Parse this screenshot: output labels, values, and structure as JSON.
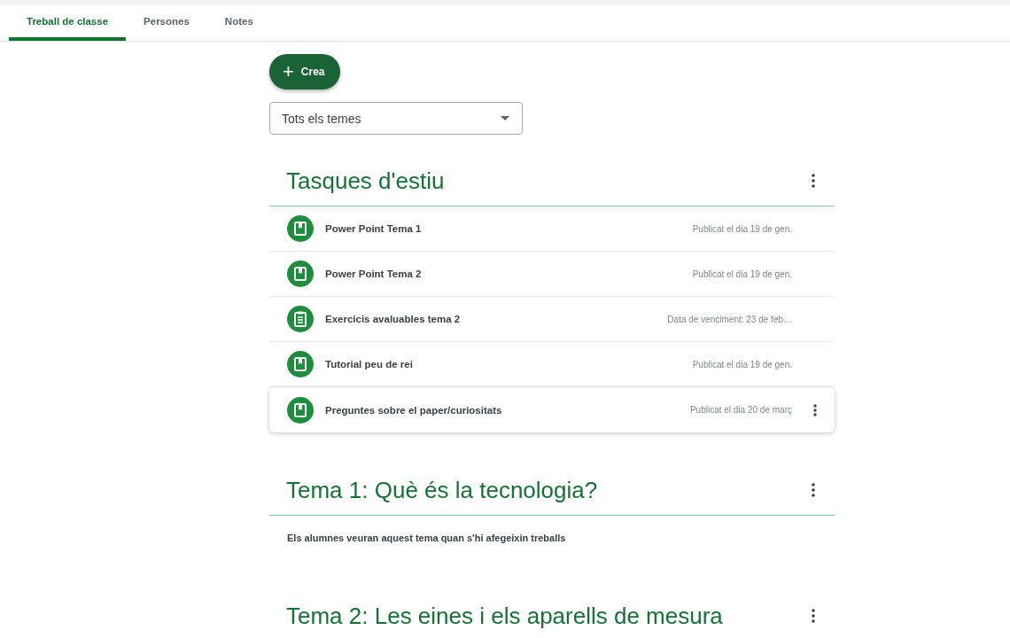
{
  "tabs": [
    {
      "label": "Treball de classe",
      "selected": true
    },
    {
      "label": "Persones",
      "selected": false
    },
    {
      "label": "Notes",
      "selected": false
    }
  ],
  "create_button": {
    "icon": "+",
    "label": "Crea"
  },
  "topic_filter": {
    "value": "Tots els temes"
  },
  "topics": [
    {
      "title": "Tasques d'estiu",
      "items": [
        {
          "kind": "material",
          "title": "Power Point Tema 1",
          "meta": "Publicat el dia 19 de gen.",
          "selected": false
        },
        {
          "kind": "material",
          "title": "Power Point Tema 2",
          "meta": "Publicat el dia 19 de gen.",
          "selected": false
        },
        {
          "kind": "assignment",
          "title": "Exercicis avaluables tema 2",
          "meta": "Data de venciment: 23 de feb…",
          "selected": false
        },
        {
          "kind": "material",
          "title": "Tutorial peu de rei",
          "meta": "Publicat el dia 19 de gen.",
          "selected": false
        },
        {
          "kind": "material",
          "title": "Preguntes sobre el paper/curiositats",
          "meta": "Publicat el dia 20 de març",
          "selected": true
        }
      ]
    },
    {
      "title": "Tema 1: Què és la tecnologia?",
      "note": "Els alumnes veuran aquest tema quan s'hi afegeixin treballs"
    },
    {
      "title": "Tema 2: Les eines i els aparells de mesura"
    }
  ]
}
